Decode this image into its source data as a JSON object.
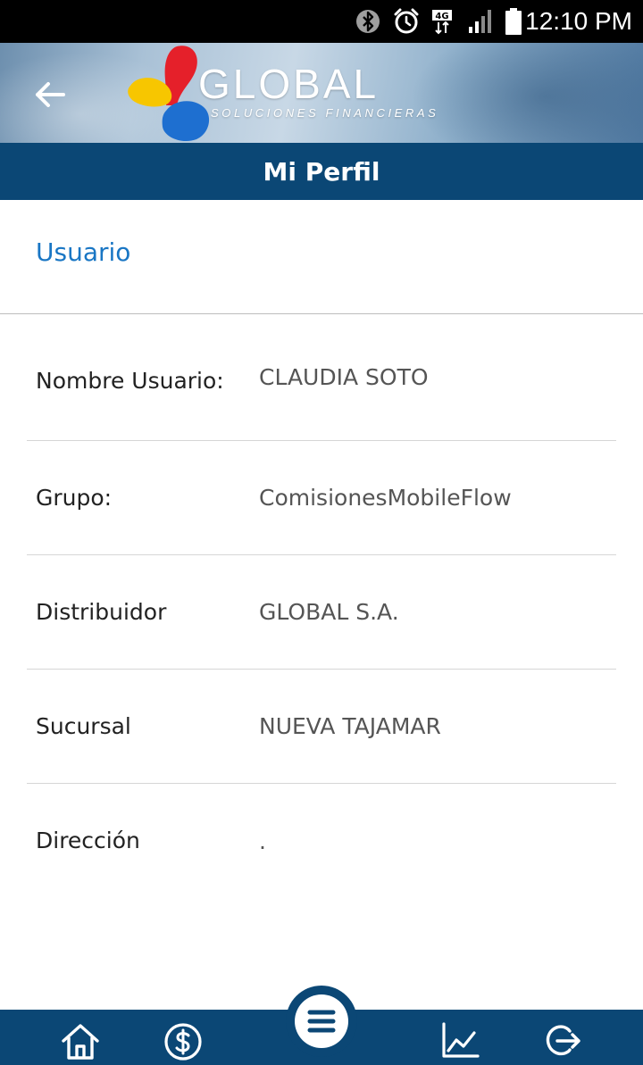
{
  "status_bar": {
    "time": "12:10 PM",
    "network": "4G",
    "icons": [
      "bluetooth-icon",
      "alarm-icon",
      "network-4g-icon",
      "signal-icon",
      "battery-icon"
    ]
  },
  "header": {
    "back_icon": "arrow-left-icon",
    "logo_text": "GLOBAL",
    "logo_tagline": "SOLUCIONES FINANCIERAS",
    "title": "Mi Perfil"
  },
  "section": {
    "label": "Usuario"
  },
  "profile": {
    "rows": [
      {
        "label": "Nombre Usuario:",
        "value": "CLAUDIA SOTO"
      },
      {
        "label": "Grupo:",
        "value": "ComisionesMobileFlow"
      },
      {
        "label": "Distribuidor",
        "value": "GLOBAL S.A."
      },
      {
        "label": "Sucursal",
        "value": "NUEVA TAJAMAR"
      },
      {
        "label": "Dirección",
        "value": "."
      }
    ]
  },
  "bottom_nav": {
    "items": [
      "home-icon",
      "dollar-icon",
      "menu-icon",
      "chart-icon",
      "logout-icon"
    ]
  },
  "colors": {
    "primary": "#0b4775",
    "accent": "#1976c4",
    "logo_red": "#e5202a",
    "logo_yellow": "#f7c600",
    "logo_blue": "#1e6fd0"
  }
}
